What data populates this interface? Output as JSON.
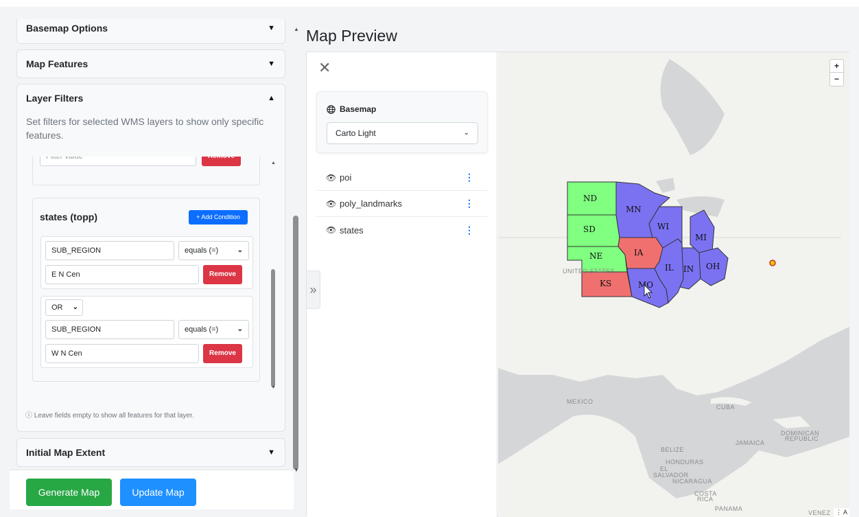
{
  "sidebar": {
    "basemap_options": "Basemap Options",
    "map_features": "Map Features",
    "layer_filters": "Layer Filters",
    "layer_filters_desc": "Set filters for selected WMS layers to show only specific features.",
    "initial_extent": "Initial Map Extent",
    "caret_down": "▼",
    "caret_up": "▲",
    "prev_placeholder": "Filter value",
    "prev_remove": "Remove",
    "states_layer": {
      "title": "states (topp)",
      "add_condition": "+ Add Condition",
      "conditions": [
        {
          "field": "SUB_REGION",
          "operator": "equals (=)",
          "value": "E N Cen",
          "remove": "Remove"
        },
        {
          "logic": "OR",
          "field": "SUB_REGION",
          "operator": "equals (=)",
          "value": "W N Cen",
          "remove": "Remove"
        }
      ]
    },
    "note": "ⓘ Leave fields empty to show all features for that layer."
  },
  "actions": {
    "generate": "Generate Map",
    "update": "Update Map"
  },
  "preview": {
    "title": "Map Preview",
    "close": "✕",
    "basemap_label": "Basemap",
    "basemap_value": "Carto Light",
    "layers": [
      {
        "name": "poi"
      },
      {
        "name": "poly_landmarks"
      },
      {
        "name": "states"
      }
    ],
    "collapse": "»",
    "zoom_in": "+",
    "zoom_out": "−",
    "map_labels": {
      "united_states": "UNITED STATES",
      "mexico": "MEXICO",
      "cuba": "CUBA",
      "dominican": "DOMINICAN",
      "republic": "REPUBLIC",
      "jamaica": "JAMAICA",
      "belize": "BELIZE",
      "honduras": "HONDURAS",
      "el": "EL",
      "salvador": "SALVADOR",
      "nicaragua": "NICARAGUA",
      "costa": "COSTA",
      "rica": "RICA",
      "panama": "PANAMA",
      "venez": "VENEZ"
    },
    "states": {
      "ND": "ND",
      "SD": "SD",
      "NE": "NE",
      "KS": "KS",
      "MN": "MN",
      "IA": "IA",
      "MO": "MO",
      "WI": "WI",
      "IL": "IL",
      "IN": "IN",
      "MI": "MI",
      "OH": "OH"
    },
    "colors": {
      "green": "#80ff80",
      "red": "#f07070",
      "blue": "#7b72f2"
    },
    "attribution": "⋮ A"
  }
}
